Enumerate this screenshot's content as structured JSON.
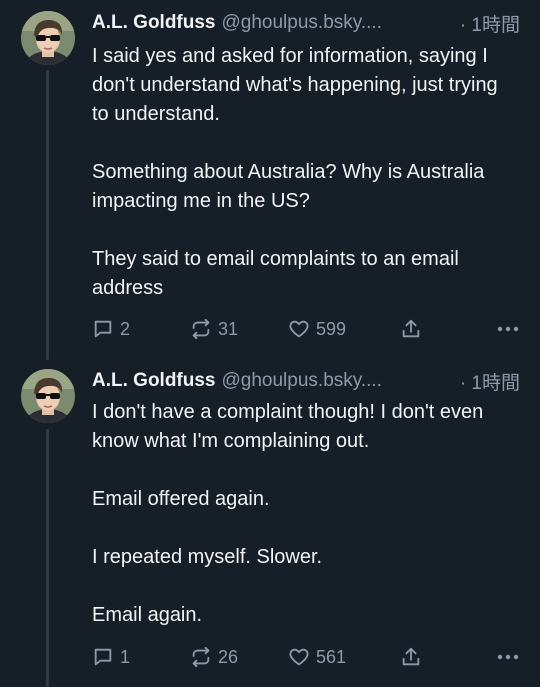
{
  "posts": [
    {
      "author": "A.L. Goldfuss",
      "handle": "@ghoulpus.bsky....",
      "time": "· 1時間",
      "paragraphs": [
        "I said yes and asked for information, saying I don't understand what's happening, just trying to understand.",
        "Something about Australia? Why is Australia impacting me in the US?",
        "They said to email complaints to an email address"
      ],
      "replies": "2",
      "reposts": "31",
      "likes": "599"
    },
    {
      "author": "A.L. Goldfuss",
      "handle": "@ghoulpus.bsky....",
      "time": "· 1時間",
      "paragraphs": [
        "I don't have a complaint though! I don't even know what I'm complaining out.",
        "Email offered again.",
        "I repeated myself. Slower.",
        "Email again."
      ],
      "replies": "1",
      "reposts": "26",
      "likes": "561"
    }
  ],
  "icons": {
    "reply": "speech-bubble-icon",
    "repost": "repost-arrows-icon",
    "like": "heart-icon",
    "share": "share-icon",
    "more": "more-dots-icon"
  },
  "colors": {
    "background": "#161e27",
    "text": "#f1f3f5",
    "muted": "#8d9aaa",
    "thread_line": "#2e3b49"
  }
}
